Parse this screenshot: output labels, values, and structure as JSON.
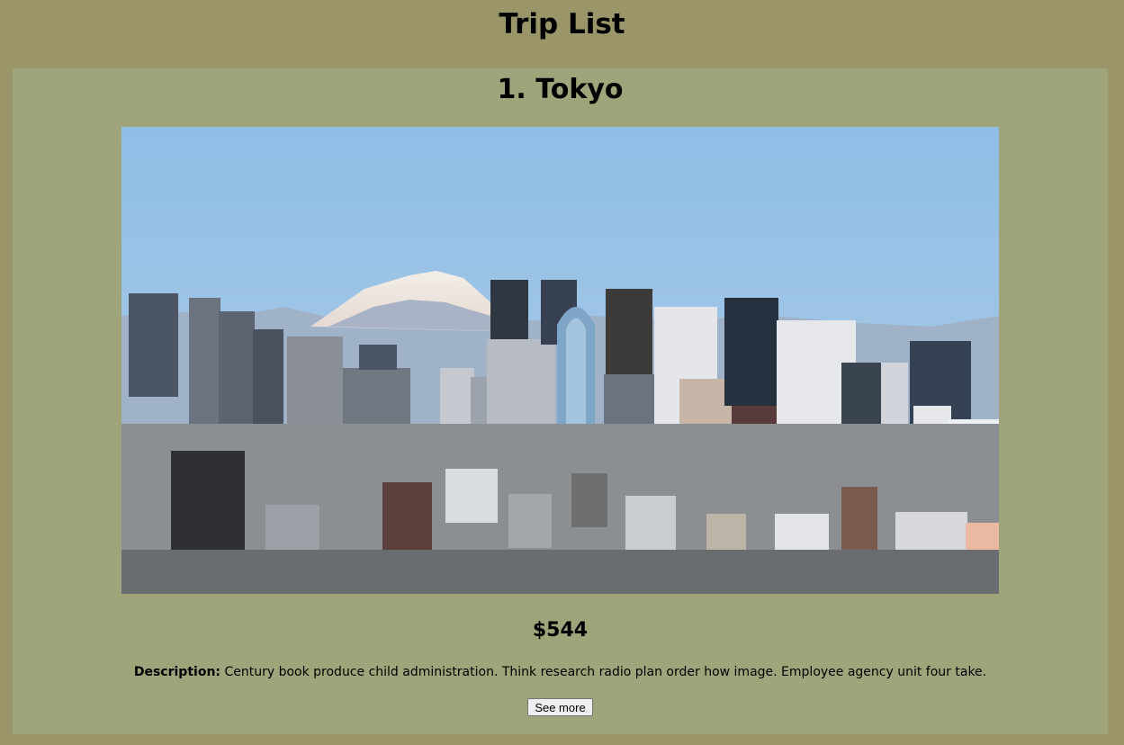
{
  "page": {
    "title": "Trip List"
  },
  "trip": {
    "heading": "1. Tokyo",
    "price": "$544",
    "description_label": "Description:",
    "description": "Century book produce child administration. Think research radio plan order how image. Employee agency unit four take.",
    "see_more_label": "See more"
  },
  "colors": {
    "page_background": "#9a9669",
    "card_background": "#a0a47b"
  }
}
